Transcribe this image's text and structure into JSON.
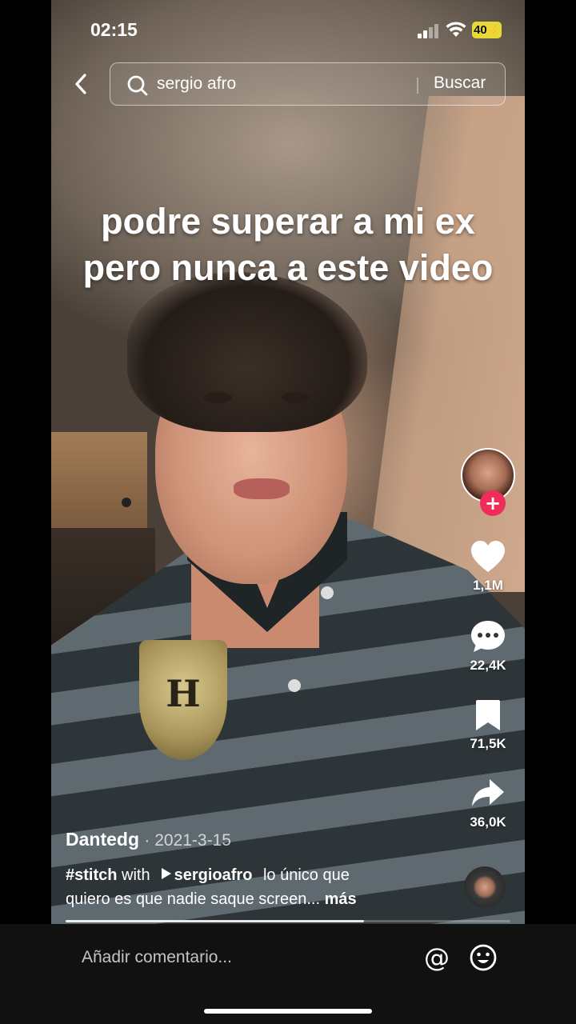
{
  "status_bar": {
    "time": "02:15",
    "battery_label": "40",
    "icons": [
      "signal-icon",
      "wifi-icon",
      "battery-charging-icon"
    ]
  },
  "search": {
    "query": "sergio afro",
    "submit_label": "Buscar",
    "icons": [
      "back-chevron-icon",
      "search-icon"
    ]
  },
  "video": {
    "overlay_caption_line1": "podre superar a mi ex",
    "overlay_caption_line2": "pero nunca a este video",
    "progress": 0.67
  },
  "actions": {
    "likes": "1,1M",
    "comments": "22,4K",
    "saves": "71,5K",
    "shares": "36,0K",
    "icons": [
      "avatar",
      "follow-plus-icon",
      "heart-icon",
      "comment-icon",
      "bookmark-icon",
      "share-icon",
      "music-disc-icon"
    ]
  },
  "post": {
    "author": "Dantedg",
    "date": "· 2021-3-15",
    "hashtag": "#stitch",
    "with_word": "with",
    "mention": "sergioafro",
    "description_part1": "lo único que",
    "description_part2": "quiero es que nadie saque screen...",
    "more_label": "más"
  },
  "comment_bar": {
    "placeholder": "Añadir comentario...",
    "mention_label": "@",
    "icons": [
      "at-icon",
      "emoji-icon"
    ]
  },
  "colors": {
    "follow_accent": "#ee2d5a",
    "battery": "#e9d83a",
    "background": "#000000"
  }
}
